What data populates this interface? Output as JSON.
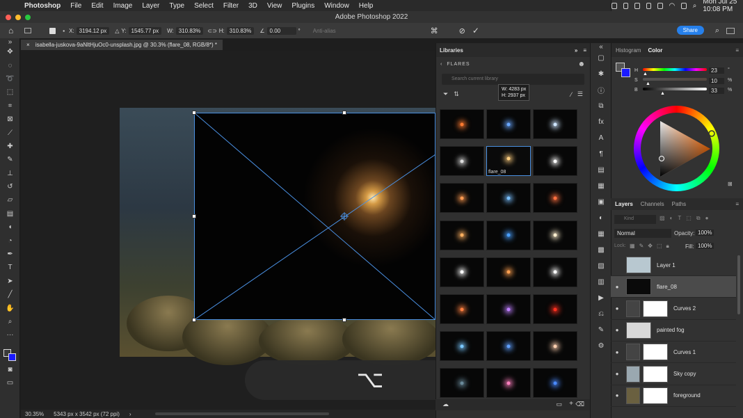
{
  "menubar": {
    "app": "Photoshop",
    "items": [
      "File",
      "Edit",
      "Image",
      "Layer",
      "Type",
      "Select",
      "Filter",
      "3D",
      "View",
      "Plugins",
      "Window",
      "Help"
    ],
    "clock": "Mon Jul 25  10:08 PM"
  },
  "window": {
    "title": "Adobe Photoshop 2022"
  },
  "options": {
    "x_label": "X:",
    "x": "3194.12 px",
    "y_label": "Y:",
    "y": "1545.77 px",
    "w_label": "W:",
    "w": "310.83%",
    "h_label": "H:",
    "h": "310.83%",
    "angle": "0.00",
    "angle_unit": "°",
    "antialias": "Anti-alias",
    "share": "Share"
  },
  "document": {
    "tab": "isabella-juskova-9aNltHjuOc0-unsplash.jpg @ 30.3% (flare_08, RGB/8*) *"
  },
  "status": {
    "zoom": "30.35%",
    "info": "5343 px x 3542 px (72 ppi)"
  },
  "shortcut_overlay": {
    "glyph": "⌥"
  },
  "libraries": {
    "title": "Libraries",
    "crumb": "FLARES",
    "search_placeholder": "Search current library",
    "tooltip_w": "W: 4283 px",
    "tooltip_h": "H: 2937 px",
    "selected_label": "flare_08"
  },
  "flare_colors": [
    "#ff7a30",
    "#6aa8ff",
    "#cfe6ff",
    "#dddddd",
    "#ffcf80",
    "#ffffff",
    "#ff9a50",
    "#7ac0ff",
    "#ff7040",
    "#ffb060",
    "#4aa0ff",
    "#fff0d0",
    "#ffffff",
    "#ffa050",
    "#ffffff",
    "#ff8040",
    "#c080ff",
    "#ff3020",
    "#7ac8ff",
    "#60a0ff",
    "#ffd0b0",
    "#6a8a9a",
    "#ff80c0",
    "#4a8aff"
  ],
  "panels": {
    "histogram": "Histogram",
    "color": "Color"
  },
  "color": {
    "h_label": "H",
    "h": "23",
    "h_unit": "°",
    "s_label": "S",
    "s": "10",
    "s_unit": "%",
    "b_label": "B",
    "b": "33",
    "b_unit": "%"
  },
  "layers_panel": {
    "tabs": [
      "Layers",
      "Channels",
      "Paths"
    ],
    "kind": "Kind",
    "blend": "Normal",
    "opacity_label": "Opacity:",
    "opacity": "100%",
    "lock_label": "Lock:",
    "fill_label": "Fill:",
    "fill": "100%"
  },
  "layers": [
    {
      "name": "Layer 1",
      "visible": false,
      "selected": false
    },
    {
      "name": "flare_08",
      "visible": true,
      "selected": true
    },
    {
      "name": "Curves 2",
      "visible": true,
      "selected": false
    },
    {
      "name": "painted fog",
      "visible": true,
      "selected": false
    },
    {
      "name": "Curves 1",
      "visible": true,
      "selected": false
    },
    {
      "name": "Sky copy",
      "visible": true,
      "selected": false
    },
    {
      "name": "foreground",
      "visible": true,
      "selected": false
    }
  ]
}
